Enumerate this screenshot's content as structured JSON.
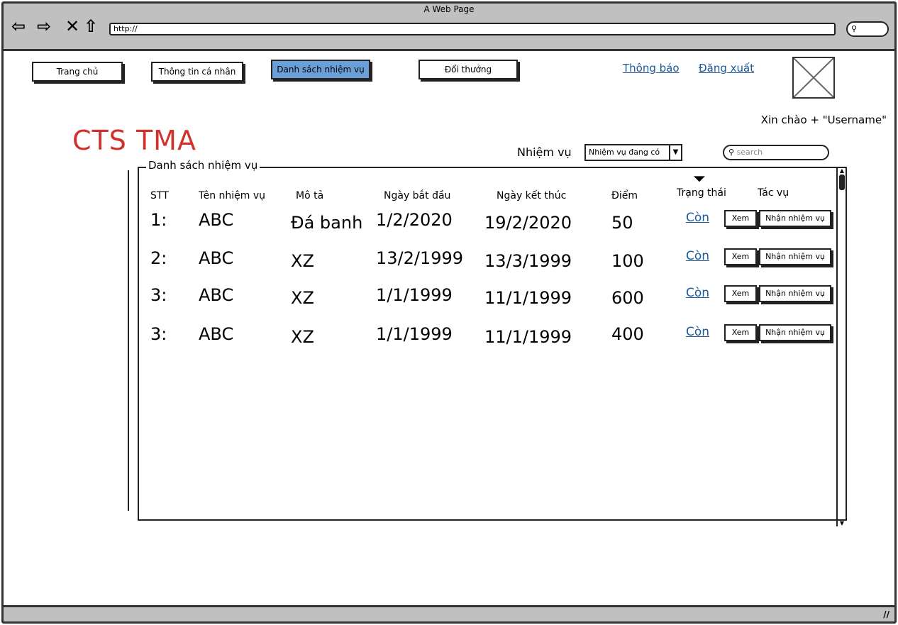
{
  "browser": {
    "title": "A Web Page",
    "url": "http://",
    "nav_icons": [
      "back-arrow-icon",
      "forward-arrow-icon",
      "close-icon",
      "home-icon"
    ]
  },
  "nav": {
    "items": [
      {
        "label": "Trang chủ"
      },
      {
        "label": "Thông tin cá nhân"
      },
      {
        "label": "Danh sách nhiệm vụ",
        "active": true
      },
      {
        "label": "Đổi thưởng"
      }
    ],
    "notifications": "Thông báo",
    "logout": "Đăng xuất",
    "greeting": "Xin chào + \"Username\""
  },
  "brand": "CTS TMA",
  "filter": {
    "label": "Nhiệm vụ",
    "selected": "Nhiệm vụ đang có",
    "search_placeholder": "search"
  },
  "panel": {
    "title": "Danh sách nhiệm vụ",
    "headers": [
      "STT",
      "Tên nhiệm vụ",
      "Mô tả",
      "Ngày bắt đầu",
      "Ngày kết thúc",
      "Điểm",
      "Trạng thái",
      "Tác vụ"
    ],
    "rows": [
      {
        "stt": "1:",
        "name": "ABC",
        "desc": "Đá banh",
        "start": "1/2/2020",
        "end": "19/2/2020",
        "score": "50",
        "status": "Còn",
        "view": "Xem",
        "accept": "Nhận nhiệm vụ"
      },
      {
        "stt": "2:",
        "name": "ABC",
        "desc": "XZ",
        "start": "13/2/1999",
        "end": "13/3/1999",
        "score": "100",
        "status": "Còn",
        "view": "Xem",
        "accept": "Nhận nhiệm vụ"
      },
      {
        "stt": "3:",
        "name": "ABC",
        "desc": "XZ",
        "start": "1/1/1999",
        "end": "11/1/1999",
        "score": "600",
        "status": "Còn",
        "view": "Xem",
        "accept": "Nhận nhiệm vụ"
      },
      {
        "stt": "3:",
        "name": "ABC",
        "desc": "XZ",
        "start": "1/1/1999",
        "end": "11/1/1999",
        "score": "400",
        "status": "Còn",
        "view": "Xem",
        "accept": "Nhận nhiệm vụ"
      }
    ]
  },
  "colors": {
    "active_nav": "#6a9fd8",
    "brand": "#d0312d",
    "link": "#1a5a9e",
    "chrome": "#c0c0c0"
  }
}
